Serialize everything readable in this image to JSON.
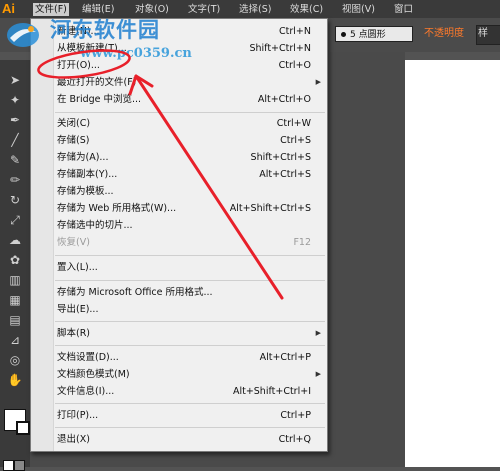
{
  "app": {
    "logo": "Ai"
  },
  "menubar": {
    "items": [
      "文件(F)",
      "编辑(E)",
      "对象(O)",
      "文字(T)",
      "选择(S)",
      "效果(C)",
      "视图(V)",
      "窗口"
    ]
  },
  "controlbar": {
    "brush_label": "5 点圆形",
    "opacity_label": "不透明度",
    "style_label": "样"
  },
  "watermark": {
    "title": "河东软件园",
    "url": "www.pc0359.cn"
  },
  "file_menu": {
    "items": [
      {
        "label": "新建(N)...",
        "shortcut": "Ctrl+N"
      },
      {
        "label": "从模板新建(T)...",
        "shortcut": "Shift+Ctrl+N"
      },
      {
        "label": "打开(O)...",
        "shortcut": "Ctrl+O"
      },
      {
        "label": "最近打开的文件(F)",
        "shortcut": "",
        "submenu": true
      },
      {
        "label": "在 Bridge 中浏览...",
        "shortcut": "Alt+Ctrl+O"
      },
      {
        "label": "关闭(C)",
        "shortcut": "Ctrl+W"
      },
      {
        "label": "存储(S)",
        "shortcut": "Ctrl+S"
      },
      {
        "label": "存储为(A)...",
        "shortcut": "Shift+Ctrl+S"
      },
      {
        "label": "存储副本(Y)...",
        "shortcut": "Alt+Ctrl+S"
      },
      {
        "label": "存储为模板...",
        "shortcut": ""
      },
      {
        "label": "存储为 Web 所用格式(W)...",
        "shortcut": "Alt+Shift+Ctrl+S"
      },
      {
        "label": "存储选中的切片...",
        "shortcut": ""
      },
      {
        "label": "恢复(V)",
        "shortcut": "F12",
        "disabled": true
      },
      {
        "label": "置入(L)...",
        "shortcut": ""
      },
      {
        "label": "存储为 Microsoft Office 所用格式...",
        "shortcut": ""
      },
      {
        "label": "导出(E)...",
        "shortcut": ""
      },
      {
        "label": "脚本(R)",
        "shortcut": "",
        "submenu": true
      },
      {
        "label": "文档设置(D)...",
        "shortcut": "Alt+Ctrl+P"
      },
      {
        "label": "文档颜色模式(M)",
        "shortcut": "",
        "submenu": true
      },
      {
        "label": "文件信息(I)...",
        "shortcut": "Alt+Shift+Ctrl+I"
      },
      {
        "label": "打印(P)...",
        "shortcut": "Ctrl+P"
      },
      {
        "label": "退出(X)",
        "shortcut": "Ctrl+Q"
      }
    ]
  },
  "annotation": {
    "color": "#e8202a"
  },
  "icons": [
    "selection-icon",
    "direct-selection-icon",
    "magic-wand-icon",
    "pen-icon",
    "type-icon",
    "line-icon",
    "brush-icon",
    "pencil-icon",
    "rotate-icon",
    "scale-icon",
    "warp-icon",
    "symbol-icon",
    "graph-icon",
    "mesh-icon",
    "gradient-icon",
    "eyedropper-icon",
    "blend-icon",
    "slice-icon",
    "hand-icon",
    "zoom-icon"
  ]
}
